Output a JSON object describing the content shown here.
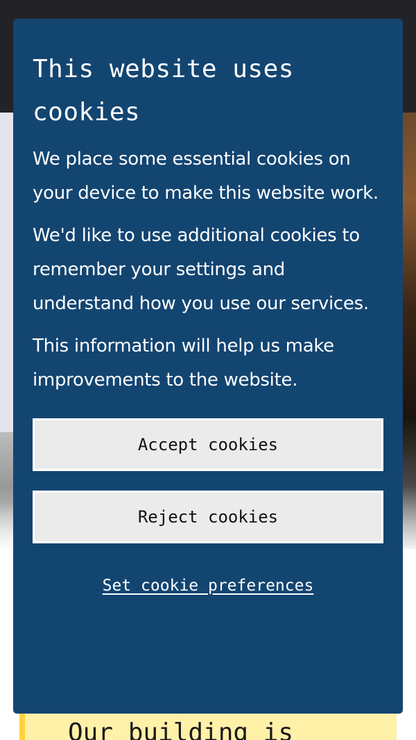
{
  "cookie_banner": {
    "title": "This website uses cookies",
    "paragraphs": [
      "We place some essential cookies on your device to make this website work.",
      "We'd like to use additional cookies to remember your settings and understand how you use our services.",
      "This information will help us make improvements to the website."
    ],
    "accept_label": "Accept cookies",
    "reject_label": "Reject cookies",
    "preferences_label": "Set cookie preferences"
  },
  "background": {
    "notice_text": "Our building is"
  },
  "colors": {
    "dialog_bg": "#134571",
    "button_bg": "#ebebeb",
    "header_bg": "#232327",
    "notice_bg": "#fff1a8",
    "notice_border": "#ffd23c"
  }
}
